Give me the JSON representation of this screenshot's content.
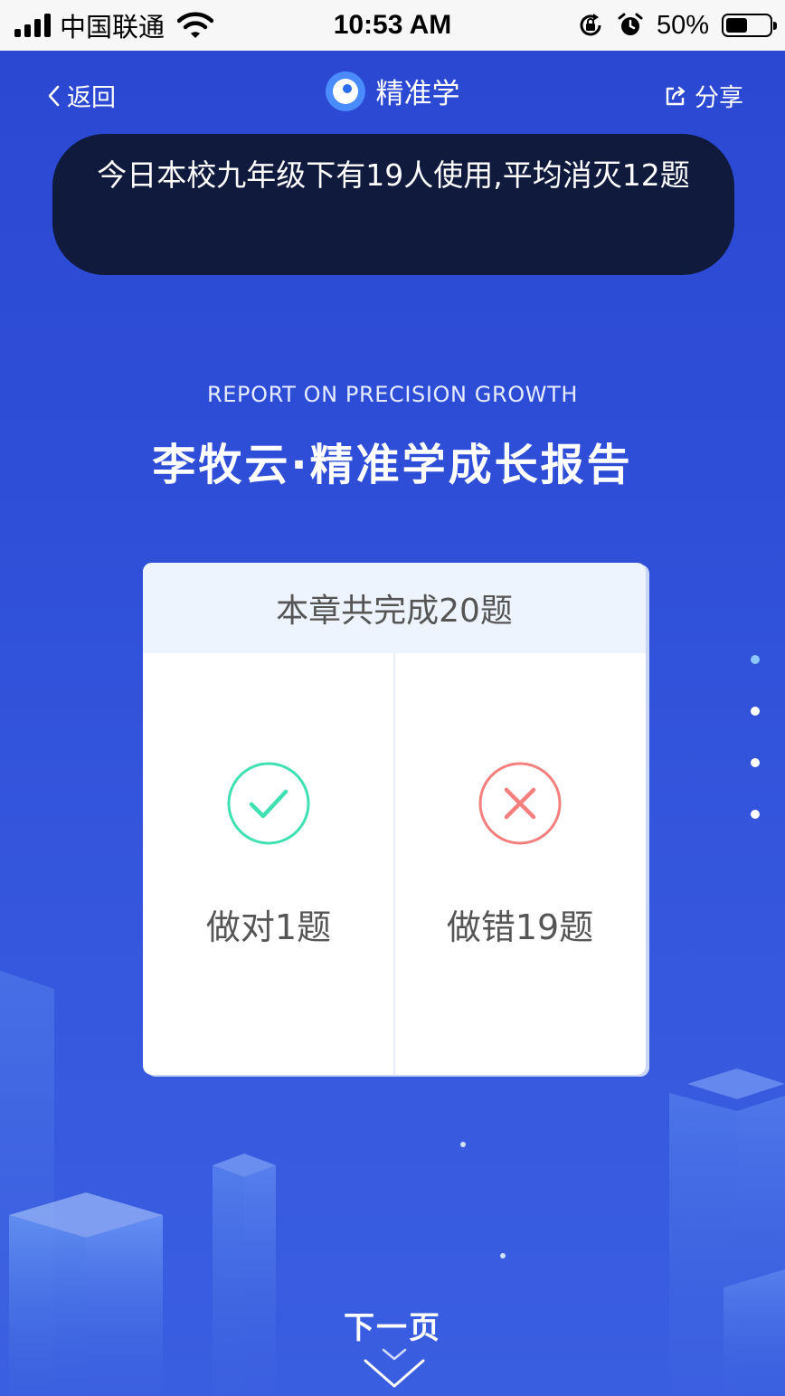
{
  "status_bar": {
    "carrier": "中国联通",
    "time": "10:53 AM",
    "battery_percent": "50%",
    "battery_level": 0.5,
    "icons": [
      "signal-icon",
      "wifi-icon",
      "orientation-lock-icon",
      "alarm-icon",
      "battery-icon"
    ]
  },
  "nav": {
    "back_label": "返回",
    "title": "精准学",
    "share_label": "分享",
    "icons": [
      "chevron-left-icon",
      "app-logo-icon",
      "share-icon"
    ]
  },
  "notice": {
    "text": "今日本校九年级下有19人使用,平均消灭12题"
  },
  "report": {
    "subtitle": "REPORT ON PRECISION GROWTH",
    "title": "李牧云·精准学成长报告"
  },
  "summary_card": {
    "header": "本章共完成20题",
    "correct": {
      "label": "做对1题",
      "icon": "check-circle-icon",
      "color": "#3fe0b2"
    },
    "wrong": {
      "label": "做错19题",
      "icon": "x-circle-icon",
      "color": "#f57f7f"
    }
  },
  "pager": {
    "count": 4,
    "active_index": 0,
    "active_color": "#8ec6ff"
  },
  "footer": {
    "next_label": "下一页",
    "icon": "double-chevron-down-icon"
  },
  "colors": {
    "background": "#2f4fd8",
    "notice_bg": "#0f1a3d",
    "card_header_bg": "#eef4fe"
  }
}
